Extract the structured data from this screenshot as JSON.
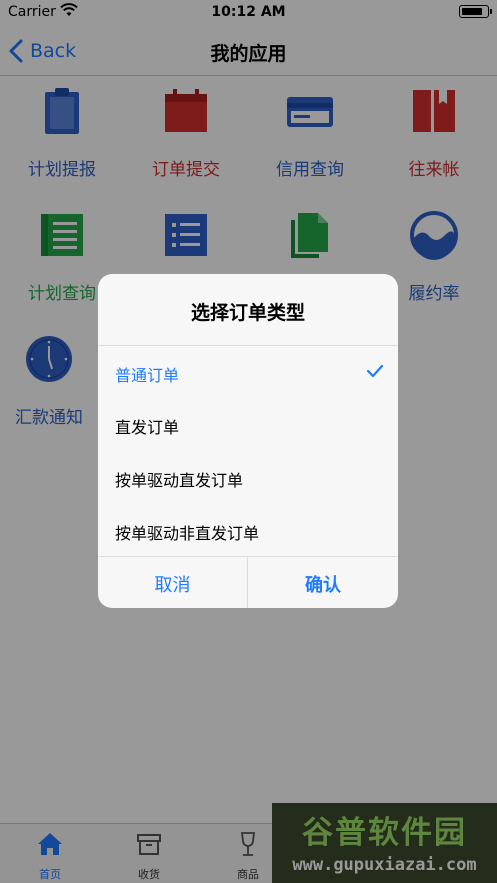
{
  "status_bar": {
    "carrier": "Carrier",
    "time": "10:12 AM"
  },
  "nav": {
    "back_label": "Back",
    "title": "我的应用"
  },
  "apps": [
    {
      "label": "计划提报",
      "icon": "clipboard-icon",
      "color": "#2f62c9"
    },
    {
      "label": "订单提交",
      "icon": "calendar-icon",
      "color": "#d32f2f"
    },
    {
      "label": "信用查询",
      "icon": "credit-card-icon",
      "color": "#2f62c9"
    },
    {
      "label": "往来帐",
      "icon": "book-icon",
      "color": "#d32f2f"
    },
    {
      "label": "计划查询",
      "icon": "document-lines-icon",
      "color": "#23a94a"
    },
    {
      "label": "",
      "icon": "list-icon",
      "color": "#2f62c9"
    },
    {
      "label": "",
      "icon": "files-icon",
      "color": "#23a94a"
    },
    {
      "label": "履约率",
      "icon": "wave-circle-icon",
      "color": "#2f62c9"
    },
    {
      "label": "汇款通知",
      "icon": "clock-icon",
      "color": "#2f62c9"
    }
  ],
  "dialog": {
    "title": "选择订单类型",
    "options": [
      {
        "label": "普通订单",
        "selected": true
      },
      {
        "label": "直发订单",
        "selected": false
      },
      {
        "label": "按单驱动直发订单",
        "selected": false
      },
      {
        "label": "按单驱动非直发订单",
        "selected": false
      }
    ],
    "cancel_label": "取消",
    "confirm_label": "确认"
  },
  "tabbar": [
    {
      "label": "首页",
      "icon": "home-icon",
      "active": true
    },
    {
      "label": "收货",
      "icon": "box-icon",
      "active": false
    },
    {
      "label": "商品",
      "icon": "wine-glass-icon",
      "active": false
    }
  ],
  "watermark": {
    "brand": "谷普软件园",
    "url": "www.gupuxiazai.com"
  },
  "colors": {
    "accent": "#1f7bff",
    "blue": "#2f62c9",
    "red": "#d32f2f",
    "green": "#23a94a"
  }
}
